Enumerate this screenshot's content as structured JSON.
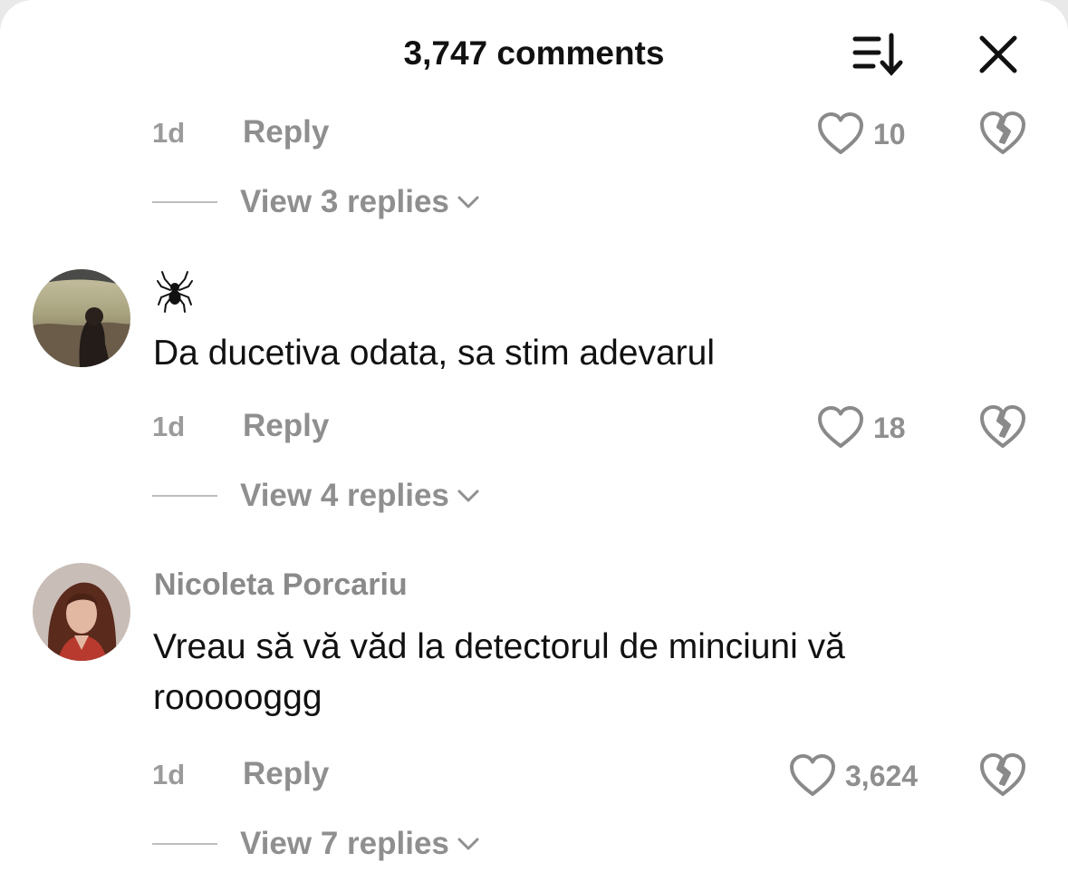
{
  "header": {
    "title": "3,747 comments"
  },
  "icons": {
    "sort": "sort-icon",
    "close": "close-icon",
    "like": "heart-outline-icon",
    "dislike": "broken-heart-icon",
    "chevron": "chevron-down-icon",
    "spider": "spider-icon"
  },
  "comments": [
    {
      "time": "1d",
      "reply_label": "Reply",
      "likes": "10",
      "view_replies": "View 3 replies"
    },
    {
      "username_icon": "spider-icon",
      "text": "Da ducetiva odata, sa stim adevarul",
      "time": "1d",
      "reply_label": "Reply",
      "likes": "18",
      "view_replies": "View 4 replies"
    },
    {
      "username": "Nicoleta Porcariu",
      "text": "Vreau să vă văd la detectorul de minciuni vă roooooggg",
      "time": "1d",
      "reply_label": "Reply",
      "likes": "3,624",
      "view_replies": "View 7 replies"
    }
  ],
  "colors": {
    "text": "#111111",
    "muted": "#8f8f8f",
    "background": "#ffffff"
  }
}
